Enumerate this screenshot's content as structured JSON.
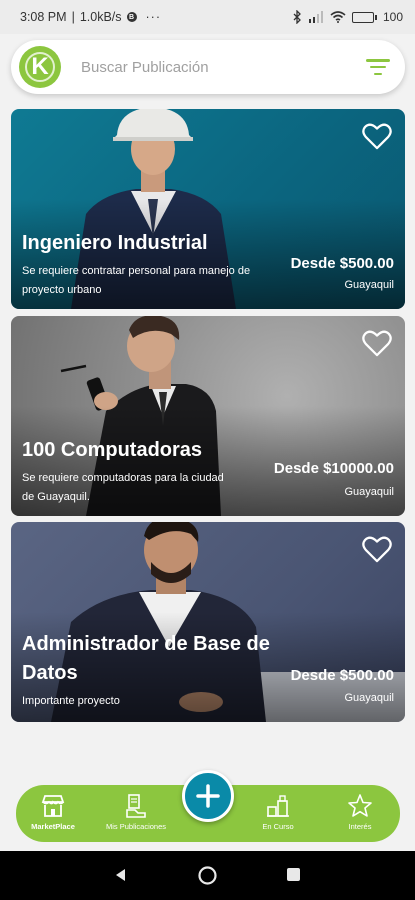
{
  "status_bar": {
    "time": "3:08 PM",
    "speed": "1.0kB/s",
    "dots": "···",
    "battery": "100"
  },
  "search": {
    "logo_letter": "K",
    "placeholder": "Buscar Publicación"
  },
  "cards": [
    {
      "title": "Ingeniero Industrial",
      "description_lines": [
        "Se requiere contratar personal para manejo de",
        "proyecto urbano"
      ],
      "price": "Desde $500.00",
      "city": "Guayaquil",
      "bg_color": "#0e6f87"
    },
    {
      "title": "100 Computadoras",
      "description_lines": [
        "Se requiere computadoras para la ciudad",
        "de Guayaquil."
      ],
      "price": "Desde $10000.00",
      "city": "Guayaquil",
      "bg_color": "#8d8d8d"
    },
    {
      "title_lines": [
        "Administrador de Base de",
        "Datos"
      ],
      "description_lines": [
        "Importante proyecto"
      ],
      "price": "Desde $500.00",
      "city": "Guayaquil",
      "bg_color": "#4d5a78"
    }
  ],
  "nav": {
    "items": [
      {
        "label": "MarketPlace",
        "icon": "store-icon",
        "active": true
      },
      {
        "label": "Mis Publicaciones",
        "icon": "publications-icon",
        "active": false
      },
      {
        "label": "En Curso",
        "icon": "in-progress-icon",
        "active": false
      },
      {
        "label": "Interés",
        "icon": "star-icon",
        "active": false
      }
    ],
    "fab_icon": "plus-icon"
  },
  "colors": {
    "accent": "#8cc63f",
    "fab": "#0a8aa8"
  }
}
